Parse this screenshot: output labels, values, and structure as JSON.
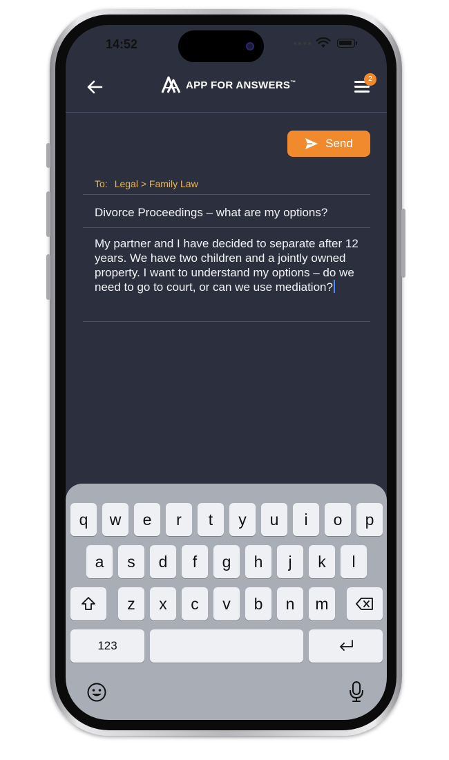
{
  "status_bar": {
    "time": "14:52"
  },
  "header": {
    "logo_text": "APP FOR ANSWERS",
    "trademark": "™",
    "menu_badge": "2"
  },
  "compose": {
    "send_label": "Send",
    "to_label": "To:",
    "to_value": "Legal > Family Law",
    "subject": "Divorce Proceedings – what are my options?",
    "body": "My partner and I have decided to separate after 12 years. We have two children and a jointly owned property. I want to understand my options – do we need to go to court, or can we use mediation?"
  },
  "keyboard": {
    "row1": [
      "q",
      "w",
      "e",
      "r",
      "t",
      "y",
      "u",
      "i",
      "o",
      "p"
    ],
    "row2": [
      "a",
      "s",
      "d",
      "f",
      "g",
      "h",
      "j",
      "k",
      "l"
    ],
    "row3": [
      "z",
      "x",
      "c",
      "v",
      "b",
      "n",
      "m"
    ],
    "numbers_key": "123"
  },
  "colors": {
    "accent": "#f08a2c",
    "screen_bg": "#2c2f3d",
    "to_text": "#e6b75c",
    "keyboard_bg": "#a9adb5"
  },
  "icons": [
    "back-arrow-icon",
    "menu-icon",
    "send-icon",
    "shift-icon",
    "backspace-icon",
    "return-icon",
    "emoji-icon",
    "microphone-icon"
  ]
}
